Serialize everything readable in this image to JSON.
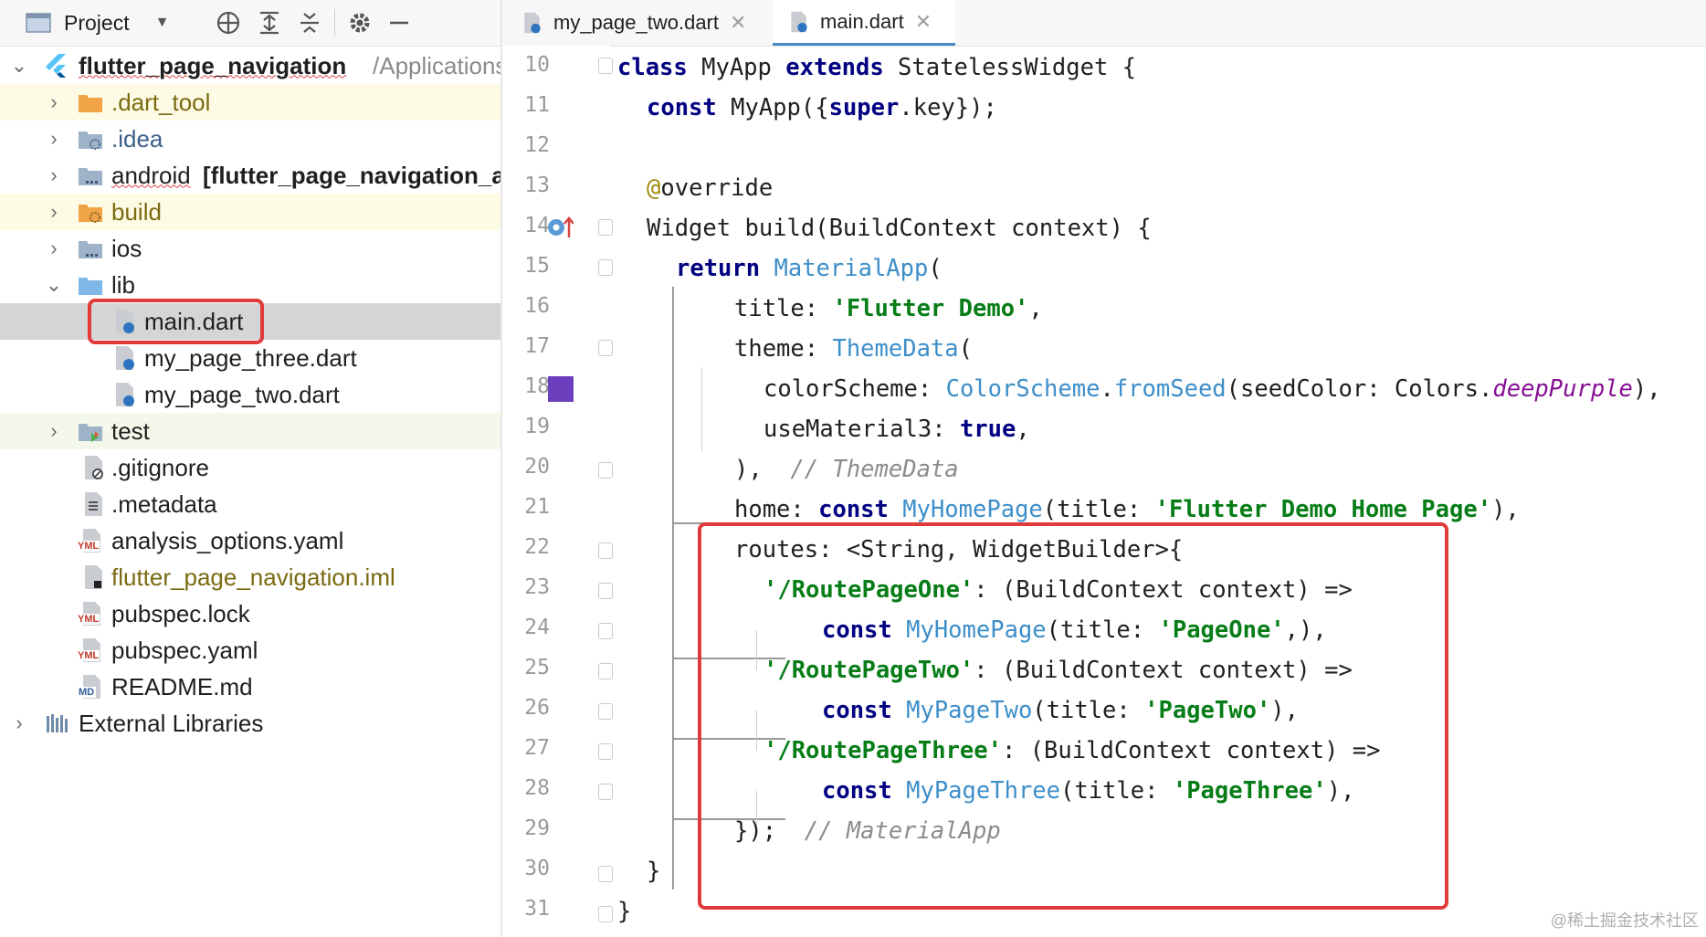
{
  "project_panel": {
    "title": "Project",
    "root": {
      "name": "flutter_page_navigation",
      "path": "/Applications/"
    },
    "tree": [
      {
        "label": ".dart_tool",
        "icon": "folder-icon"
      },
      {
        "label": ".idea",
        "icon": "settings-folder-icon"
      },
      {
        "label": "android",
        "module": "[flutter_page_navigation_android]",
        "icon": "module-folder-icon"
      },
      {
        "label": "build",
        "icon": "build-folder-icon"
      },
      {
        "label": "ios",
        "icon": "module-folder-icon"
      },
      {
        "label": "lib",
        "icon": "folder-icon"
      },
      {
        "label": "main.dart",
        "icon": "dart-file-icon"
      },
      {
        "label": "my_page_three.dart",
        "icon": "dart-file-icon"
      },
      {
        "label": "my_page_two.dart",
        "icon": "dart-file-icon"
      },
      {
        "label": "test",
        "icon": "test-folder-icon"
      },
      {
        "label": ".gitignore",
        "icon": "gitignore-file-icon"
      },
      {
        "label": ".metadata",
        "icon": "text-file-icon"
      },
      {
        "label": "analysis_options.yaml",
        "icon": "yaml-file-icon"
      },
      {
        "label": "flutter_page_navigation.iml",
        "icon": "iml-file-icon"
      },
      {
        "label": "pubspec.lock",
        "icon": "yaml-file-icon"
      },
      {
        "label": "pubspec.yaml",
        "icon": "yaml-file-icon"
      },
      {
        "label": "README.md",
        "icon": "markdown-file-icon"
      },
      {
        "label": "External Libraries",
        "icon": "libraries-icon"
      }
    ],
    "yml_badge": "YML",
    "md_badge": "MD"
  },
  "editor": {
    "tabs": [
      {
        "label": "my_page_two.dart",
        "active": false
      },
      {
        "label": "main.dart",
        "active": true
      }
    ],
    "line_numbers": [
      "10",
      "11",
      "12",
      "13",
      "14",
      "15",
      "16",
      "17",
      "18",
      "19",
      "20",
      "21",
      "22",
      "23",
      "24",
      "25",
      "26",
      "27",
      "28",
      "29",
      "30",
      "31"
    ],
    "code": {
      "l10": [
        "class",
        " MyApp ",
        "extends",
        " StatelessWidget {"
      ],
      "l11": [
        "const",
        " MyApp({",
        "super",
        ".key});"
      ],
      "l13": [
        "@",
        "override"
      ],
      "l14": [
        "Widget build(BuildContext context) {"
      ],
      "l15": [
        "return",
        " ",
        "MaterialApp",
        "("
      ],
      "l16": [
        "title: ",
        "'Flutter Demo'",
        ","
      ],
      "l17": [
        "theme: ",
        "ThemeData",
        "("
      ],
      "l18": [
        "colorScheme: ",
        "ColorScheme",
        ".",
        "fromSeed",
        "(seedColor: Colors.",
        "deepPurple",
        "),"
      ],
      "l19": [
        "useMaterial3: ",
        "true",
        ","
      ],
      "l20": [
        "),  ",
        "// ThemeData"
      ],
      "l21": [
        "home: ",
        "const",
        " ",
        "MyHomePage",
        "(title: ",
        "'Flutter Demo Home Page'",
        "),"
      ],
      "l22": [
        "routes: <String, WidgetBuilder>{"
      ],
      "l23": [
        "'/RoutePageOne'",
        ": (BuildContext context) =>"
      ],
      "l24": [
        "const",
        " ",
        "MyHomePage",
        "(title: ",
        "'PageOne'",
        ",),"
      ],
      "l25": [
        "'/RoutePageTwo'",
        ": (BuildContext context) =>"
      ],
      "l26": [
        "const",
        " ",
        "MyPageTwo",
        "(title: ",
        "'PageTwo'",
        "),"
      ],
      "l27": [
        "'/RoutePageThree'",
        ": (BuildContext context) =>"
      ],
      "l28": [
        "const",
        " ",
        "MyPageThree",
        "(title: ",
        "'PageThree'",
        "),"
      ],
      "l29": [
        "});  ",
        "// MaterialApp"
      ],
      "l30": [
        "}"
      ],
      "l31": [
        "}"
      ]
    }
  },
  "colors": {
    "annotation_box": "#e03a3a",
    "color_swatch": "#6c3fbf",
    "keyword": "#000080",
    "string": "#067d17",
    "class_ref": "#3d8ec9"
  },
  "watermark": "@稀土掘金技术社区"
}
